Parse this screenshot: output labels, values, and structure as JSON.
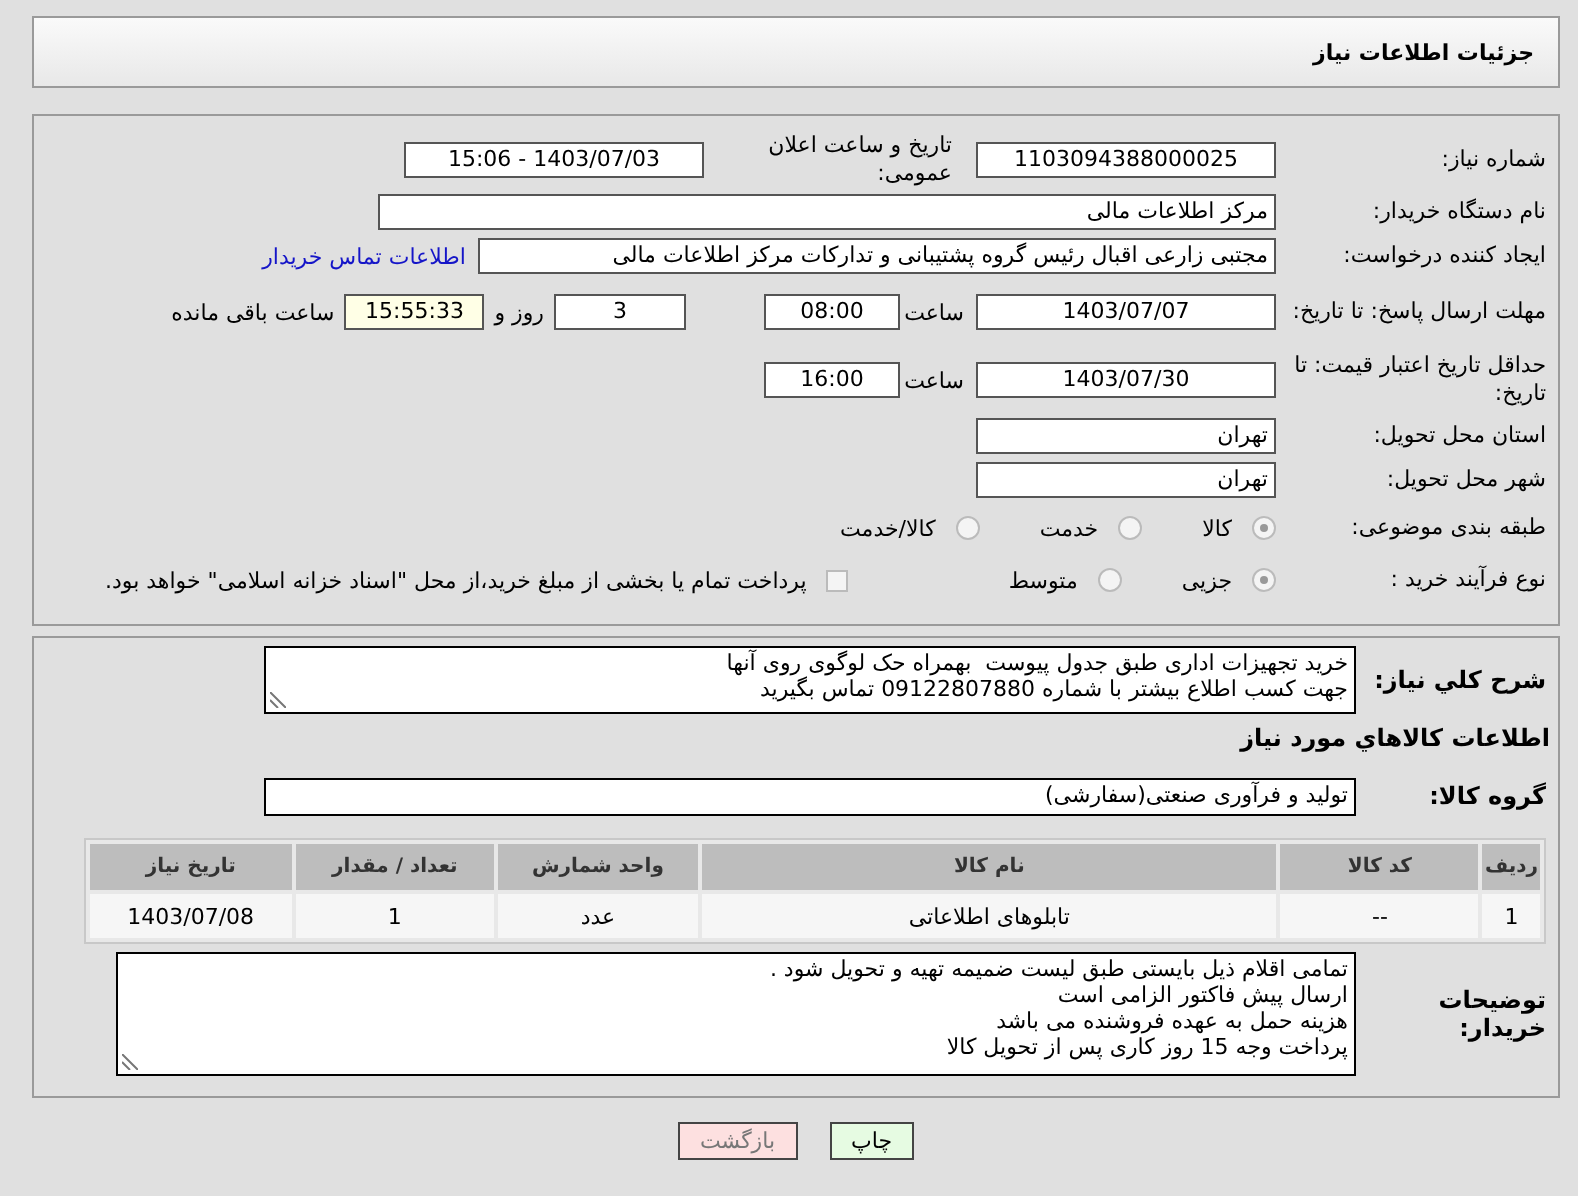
{
  "header": {
    "title": "جزئیات اطلاعات نیاز"
  },
  "need_number": {
    "label": "شماره نیاز:",
    "value": "1103094388000025"
  },
  "announce": {
    "label": "تاریخ و ساعت اعلان عمومی:",
    "value": "1403/07/03 - 15:06"
  },
  "buyer_org": {
    "label": "نام دستگاه خریدار:",
    "value": "مرکز اطلاعات مالی"
  },
  "requester": {
    "label": "ایجاد کننده درخواست:",
    "value": "مجتبی زارعی اقبال رئیس گروه پشتیبانی و تدارکات مرکز اطلاعات مالی",
    "contact_link": "اطلاعات تماس خریدار"
  },
  "response_deadline": {
    "label": "مهلت ارسال پاسخ: تا تاریخ:",
    "date": "1403/07/07",
    "time_label": "ساعت",
    "time": "08:00",
    "days": "3",
    "days_label": "روز و",
    "remaining": "15:55:33",
    "remaining_label": "ساعت باقی مانده"
  },
  "price_validity": {
    "label": "حداقل تاریخ اعتبار قیمت: تا تاریخ:",
    "date": "1403/07/30",
    "time_label": "ساعت",
    "time": "16:00"
  },
  "province": {
    "label": "استان محل تحویل:",
    "value": "تهران"
  },
  "city": {
    "label": "شهر محل تحویل:",
    "value": "تهران"
  },
  "category": {
    "label": "طبقه بندی موضوعی:",
    "options": [
      {
        "label": "کالا",
        "selected": true
      },
      {
        "label": "خدمت",
        "selected": false
      },
      {
        "label": "کالا/خدمت",
        "selected": false
      }
    ]
  },
  "process": {
    "label": "نوع فرآیند خرید :",
    "options": [
      {
        "label": "جزیی",
        "selected": true
      },
      {
        "label": "متوسط",
        "selected": false
      }
    ],
    "payment_checkbox": {
      "label": "پرداخت تمام یا بخشی از مبلغ خرید،از محل \"اسناد خزانه اسلامی\" خواهد بود.",
      "checked": false
    }
  },
  "description": {
    "label": "شرح کلي نياز:",
    "lines": [
      "خرید تجهیزات اداری طبق جدول پیوست  بهمراه حک لوگوی روی آنها",
      "جهت کسب اطلاع بیشتر با شماره 09122807880 تماس بگیرید"
    ]
  },
  "goods_heading": "اطلاعات کالاهاي مورد نياز",
  "goods_group": {
    "label": "گروه کالا:",
    "value": "تولید و فرآوری صنعتی(سفارشی)"
  },
  "table": {
    "columns": [
      "ردیف",
      "کد کالا",
      "نام کالا",
      "واحد شمارش",
      "تعداد / مقدار",
      "تاریخ نیاز"
    ],
    "rows": [
      [
        "1",
        "--",
        "تابلوهای اطلاعاتی",
        "عدد",
        "1",
        "1403/07/08"
      ]
    ]
  },
  "buyer_notes": {
    "label": "توضیحات خریدار:",
    "lines": [
      "تمامی اقلام ذیل بایستی طبق لیست ضمیمه تهیه و تحویل شود .",
      "ارسال پیش فاکتور الزامی است",
      "هزینه حمل به عهده فروشنده می باشد",
      "پرداخت وجه 15 روز کاری پس از تحویل کالا"
    ]
  },
  "buttons": [
    {
      "label": "چاپ",
      "kind": "print"
    },
    {
      "label": "بازگشت",
      "kind": "back"
    }
  ]
}
